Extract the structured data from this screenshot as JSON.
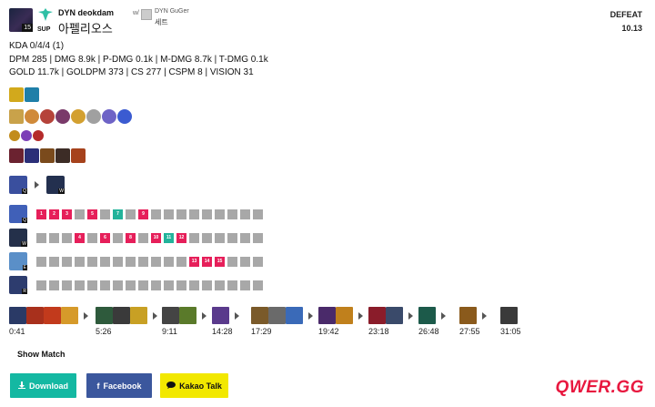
{
  "header": {
    "level": "15",
    "role": "SUP",
    "player_name": "DYN deokdam",
    "champion": "아펠리오스",
    "with_label": "w/",
    "partner_name": "DYN GuGer",
    "partner_champion": "세트",
    "result": "DEFEAT",
    "patch": "10.13"
  },
  "stats": {
    "line1": "KDA 0/4/4 (1)",
    "line2": "DPM 285 | DMG 8.9k | P-DMG 0.1k | M-DMG 8.7k | T-DMG 0.1k",
    "line3": "GOLD 11.7k | GOLDPM 373 | CS 277 | CSPM 8 | VISION 31"
  },
  "spells": [
    {
      "icon": "heal-spell-icon",
      "color": "#d2a91c"
    },
    {
      "icon": "flash-spell-icon",
      "color": "#1f7fa8"
    }
  ],
  "runes": [
    {
      "icon": "keystone-rune-icon",
      "color": "#c9a24a"
    },
    {
      "icon": "rune-2-icon",
      "color": "#d08a3a"
    },
    {
      "icon": "rune-3-icon",
      "color": "#b5433a"
    },
    {
      "icon": "rune-4-icon",
      "color": "#7a3a6a"
    },
    {
      "icon": "rune-5-icon",
      "color": "#d3a030"
    },
    {
      "icon": "rune-6-icon",
      "color": "#a0a0a0"
    },
    {
      "icon": "rune-7-icon",
      "color": "#6e63c6"
    },
    {
      "icon": "rune-8-icon",
      "color": "#3b5bd1"
    }
  ],
  "shards": [
    {
      "icon": "shard-adaptive-icon",
      "color": "#c28c1c"
    },
    {
      "icon": "shard-adaptive2-icon",
      "color": "#7c3fb7"
    },
    {
      "icon": "shard-armor-icon",
      "color": "#b52b2b"
    }
  ],
  "starting_items": [
    {
      "icon": "item-1-icon",
      "color": "#6b2230"
    },
    {
      "icon": "item-2-icon",
      "color": "#2b2f78"
    },
    {
      "icon": "item-3-icon",
      "color": "#7a4a1c"
    },
    {
      "icon": "item-4-icon",
      "color": "#3c2c26"
    },
    {
      "icon": "item-5-icon",
      "color": "#a6421c"
    }
  ],
  "skill_order": {
    "from_key": "Q",
    "to_key": "W",
    "from_color": "#3a4f9e",
    "to_color": "#23304f"
  },
  "skills": [
    {
      "key": "Q",
      "color": "#4060b8",
      "cells": [
        {
          "t": "1",
          "c": "pink"
        },
        {
          "t": "2",
          "c": "pink"
        },
        {
          "t": "3",
          "c": "pink"
        },
        {
          "t": "",
          "c": ""
        },
        {
          "t": "5",
          "c": "pink"
        },
        {
          "t": "",
          "c": ""
        },
        {
          "t": "7",
          "c": "teal"
        },
        {
          "t": "",
          "c": ""
        },
        {
          "t": "9",
          "c": "pink"
        },
        {
          "t": "",
          "c": ""
        },
        {
          "t": "",
          "c": ""
        },
        {
          "t": "",
          "c": ""
        },
        {
          "t": "",
          "c": ""
        },
        {
          "t": "",
          "c": ""
        },
        {
          "t": "",
          "c": ""
        },
        {
          "t": "",
          "c": ""
        },
        {
          "t": "",
          "c": ""
        },
        {
          "t": "",
          "c": ""
        }
      ]
    },
    {
      "key": "W",
      "color": "#24304a",
      "cells": [
        {
          "t": "",
          "c": ""
        },
        {
          "t": "",
          "c": ""
        },
        {
          "t": "",
          "c": ""
        },
        {
          "t": "4",
          "c": "pink"
        },
        {
          "t": "",
          "c": ""
        },
        {
          "t": "6",
          "c": "pink"
        },
        {
          "t": "",
          "c": ""
        },
        {
          "t": "8",
          "c": "pink"
        },
        {
          "t": "",
          "c": ""
        },
        {
          "t": "10",
          "c": "pink"
        },
        {
          "t": "11",
          "c": "teal"
        },
        {
          "t": "12",
          "c": "pink"
        },
        {
          "t": "",
          "c": ""
        },
        {
          "t": "",
          "c": ""
        },
        {
          "t": "",
          "c": ""
        },
        {
          "t": "",
          "c": ""
        },
        {
          "t": "",
          "c": ""
        },
        {
          "t": "",
          "c": ""
        }
      ]
    },
    {
      "key": "E",
      "color": "#5a8fc8",
      "cells": [
        {
          "t": "",
          "c": ""
        },
        {
          "t": "",
          "c": ""
        },
        {
          "t": "",
          "c": ""
        },
        {
          "t": "",
          "c": ""
        },
        {
          "t": "",
          "c": ""
        },
        {
          "t": "",
          "c": ""
        },
        {
          "t": "",
          "c": ""
        },
        {
          "t": "",
          "c": ""
        },
        {
          "t": "",
          "c": ""
        },
        {
          "t": "",
          "c": ""
        },
        {
          "t": "",
          "c": ""
        },
        {
          "t": "",
          "c": ""
        },
        {
          "t": "13",
          "c": "pink"
        },
        {
          "t": "14",
          "c": "pink"
        },
        {
          "t": "15",
          "c": "pink"
        },
        {
          "t": "",
          "c": ""
        },
        {
          "t": "",
          "c": ""
        },
        {
          "t": "",
          "c": ""
        }
      ]
    },
    {
      "key": "R",
      "color": "#2d3c6e",
      "cells": [
        {
          "t": "",
          "c": ""
        },
        {
          "t": "",
          "c": ""
        },
        {
          "t": "",
          "c": ""
        },
        {
          "t": "",
          "c": ""
        },
        {
          "t": "",
          "c": ""
        },
        {
          "t": "",
          "c": ""
        },
        {
          "t": "",
          "c": ""
        },
        {
          "t": "",
          "c": ""
        },
        {
          "t": "",
          "c": ""
        },
        {
          "t": "",
          "c": ""
        },
        {
          "t": "",
          "c": ""
        },
        {
          "t": "",
          "c": ""
        },
        {
          "t": "",
          "c": ""
        },
        {
          "t": "",
          "c": ""
        },
        {
          "t": "",
          "c": ""
        },
        {
          "t": "",
          "c": ""
        },
        {
          "t": "",
          "c": ""
        },
        {
          "t": "",
          "c": ""
        }
      ]
    }
  ],
  "build": [
    {
      "time": "0:41",
      "items": [
        "#2a3a66",
        "#a8301c",
        "#c23a1c",
        "#d69a2a"
      ]
    },
    {
      "time": "5:26",
      "items": [
        "#2e5a3c",
        "#3a3a3a",
        "#c8a024"
      ]
    },
    {
      "time": "9:11",
      "items": [
        "#444",
        "#5a7a2a"
      ]
    },
    {
      "time": "14:28",
      "items": [
        "#5a3a8c"
      ]
    },
    {
      "time": "17:29",
      "items": [
        "#7a5a2a",
        "#6a6a6a",
        "#3a6ab8"
      ]
    },
    {
      "time": "19:42",
      "items": [
        "#4a2a6a",
        "#c0801c"
      ]
    },
    {
      "time": "23:18",
      "items": [
        "#8a1c2a",
        "#3a4a6a"
      ]
    },
    {
      "time": "26:48",
      "items": [
        "#1c5a4a"
      ]
    },
    {
      "time": "27:55",
      "items": [
        "#8a5a1c"
      ]
    },
    {
      "time": "31:05",
      "items": [
        "#3a3a3a"
      ]
    }
  ],
  "show_match": "Show Match",
  "buttons": {
    "download": "Download",
    "facebook": "Facebook",
    "kakao": "Kakao Talk"
  },
  "brand": "QWER.GG"
}
